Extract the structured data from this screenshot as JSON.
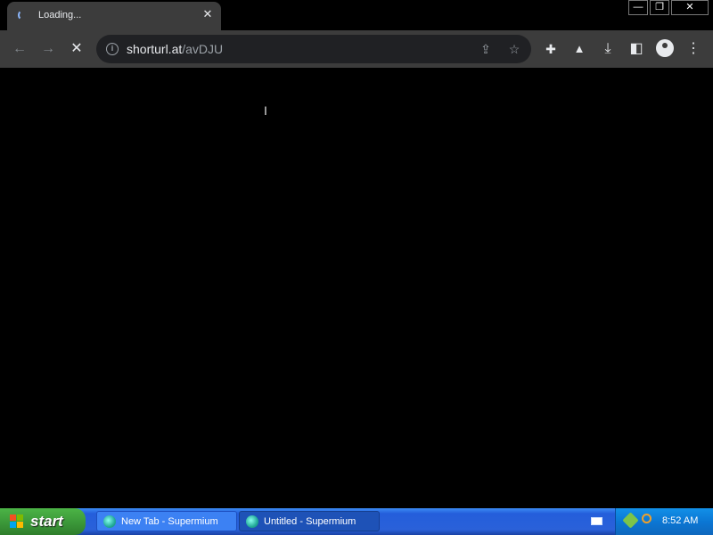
{
  "browser": {
    "tab": {
      "title": "Loading...",
      "close_label": "✕"
    },
    "window_controls": {
      "minimize": "—",
      "restore": "❐",
      "close": "✕"
    },
    "toolbar": {
      "back_icon": "←",
      "forward_icon": "→",
      "stop_icon": "✕",
      "info_icon": "i",
      "url_host": "shorturl.at",
      "url_path": "/avDJU",
      "share_icon": "⇪",
      "star_icon": "☆",
      "extensions_icon": "✚",
      "labs_icon": "▲",
      "download_icon": "⤓",
      "sidepanel_icon": "◧",
      "menu_icon": "⋮"
    }
  },
  "taskbar": {
    "start_label": "start",
    "tasks": [
      {
        "label": "New Tab - Supermium"
      },
      {
        "label": "Untitled - Supermium"
      }
    ],
    "clock": "8:52 AM"
  }
}
